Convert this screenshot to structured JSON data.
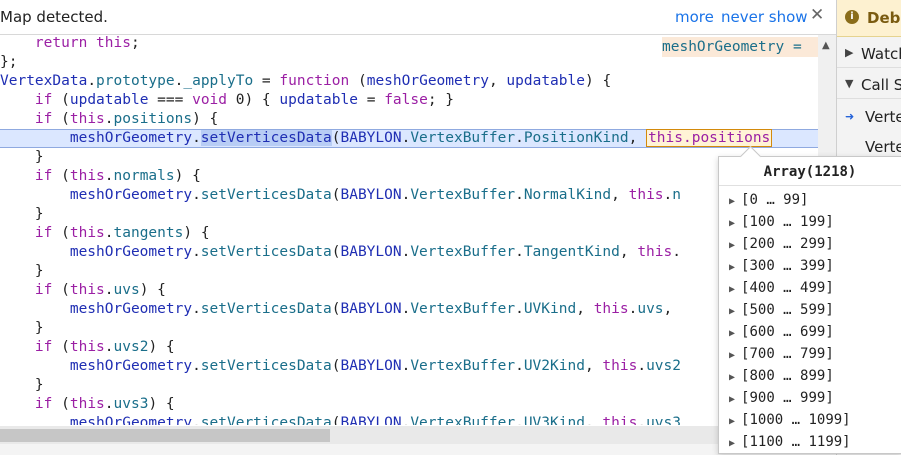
{
  "infobar": {
    "message": "Map detected.",
    "more": "more",
    "never_show": "never show",
    "close": "✕"
  },
  "debug_panel": {
    "title": "Debu",
    "watch": "Watch",
    "call_stack": "Call S",
    "frames": [
      "Verte",
      "Verte"
    ]
  },
  "code": {
    "inline_hint": "meshOrGeometry = ",
    "lines": [
      "    return this;",
      "};",
      "VertexData.prototype._applyTo = function (meshOrGeometry, updatable) {",
      "    if (updatable === void 0) { updatable = false; }",
      "    if (this.positions) {",
      "        meshOrGeometry.setVerticesData(BABYLON.VertexBuffer.PositionKind, this.positions",
      "    }",
      "    if (this.normals) {",
      "        meshOrGeometry.setVerticesData(BABYLON.VertexBuffer.NormalKind, this.n",
      "    }",
      "    if (this.tangents) {",
      "        meshOrGeometry.setVerticesData(BABYLON.VertexBuffer.TangentKind, this.",
      "    }",
      "    if (this.uvs) {",
      "        meshOrGeometry.setVerticesData(BABYLON.VertexBuffer.UVKind, this.uvs,",
      "    }",
      "    if (this.uvs2) {",
      "        meshOrGeometry.setVerticesData(BABYLON.VertexBuffer.UV2Kind, this.uvs2",
      "    }",
      "    if (this.uvs3) {",
      "        meshOrGeometry.setVerticesData(BABYLON.VertexBuffer.UV3Kind, this.uvs3"
    ]
  },
  "tooltip": {
    "header": "Array(1218)",
    "items": [
      "[0 … 99]",
      "[100 … 199]",
      "[200 … 299]",
      "[300 … 399]",
      "[400 … 499]",
      "[500 … 599]",
      "[600 … 699]",
      "[700 … 799]",
      "[800 … 899]",
      "[900 … 999]",
      "[1000 … 1099]",
      "[1100 … 1199]"
    ]
  },
  "icons": {
    "info": "info-icon",
    "close": "close-icon",
    "expand": "expand-triangle-icon",
    "current_frame": "current-frame-arrow-icon",
    "scroll_up": "scroll-up-arrow-icon"
  },
  "colors": {
    "keyword": "#9b1fa4",
    "identifier": "#1f2eb3",
    "property": "#1a6e8a",
    "highlight_line": "#dbe7ff",
    "link": "#1a73e8"
  }
}
